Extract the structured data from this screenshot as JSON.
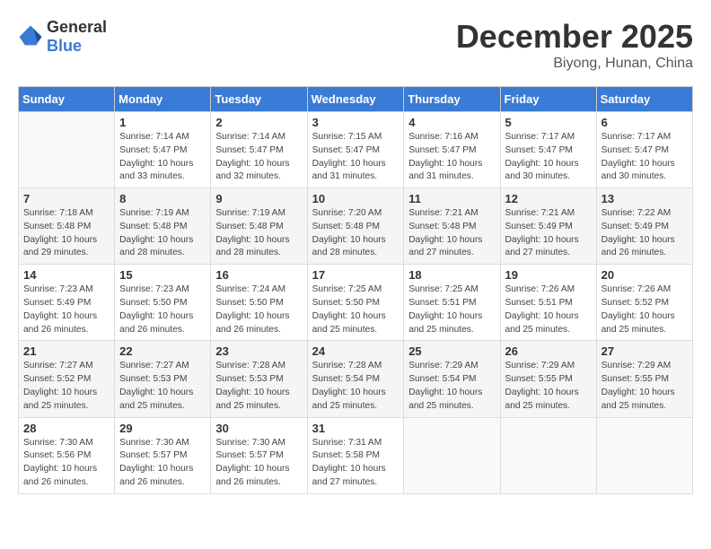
{
  "logo": {
    "general": "General",
    "blue": "Blue"
  },
  "header": {
    "month": "December 2025",
    "location": "Biyong, Hunan, China"
  },
  "weekdays": [
    "Sunday",
    "Monday",
    "Tuesday",
    "Wednesday",
    "Thursday",
    "Friday",
    "Saturday"
  ],
  "weeks": [
    [
      {
        "day": "",
        "info": ""
      },
      {
        "day": "1",
        "info": "Sunrise: 7:14 AM\nSunset: 5:47 PM\nDaylight: 10 hours\nand 33 minutes."
      },
      {
        "day": "2",
        "info": "Sunrise: 7:14 AM\nSunset: 5:47 PM\nDaylight: 10 hours\nand 32 minutes."
      },
      {
        "day": "3",
        "info": "Sunrise: 7:15 AM\nSunset: 5:47 PM\nDaylight: 10 hours\nand 31 minutes."
      },
      {
        "day": "4",
        "info": "Sunrise: 7:16 AM\nSunset: 5:47 PM\nDaylight: 10 hours\nand 31 minutes."
      },
      {
        "day": "5",
        "info": "Sunrise: 7:17 AM\nSunset: 5:47 PM\nDaylight: 10 hours\nand 30 minutes."
      },
      {
        "day": "6",
        "info": "Sunrise: 7:17 AM\nSunset: 5:47 PM\nDaylight: 10 hours\nand 30 minutes."
      }
    ],
    [
      {
        "day": "7",
        "info": "Sunrise: 7:18 AM\nSunset: 5:48 PM\nDaylight: 10 hours\nand 29 minutes."
      },
      {
        "day": "8",
        "info": "Sunrise: 7:19 AM\nSunset: 5:48 PM\nDaylight: 10 hours\nand 28 minutes."
      },
      {
        "day": "9",
        "info": "Sunrise: 7:19 AM\nSunset: 5:48 PM\nDaylight: 10 hours\nand 28 minutes."
      },
      {
        "day": "10",
        "info": "Sunrise: 7:20 AM\nSunset: 5:48 PM\nDaylight: 10 hours\nand 28 minutes."
      },
      {
        "day": "11",
        "info": "Sunrise: 7:21 AM\nSunset: 5:48 PM\nDaylight: 10 hours\nand 27 minutes."
      },
      {
        "day": "12",
        "info": "Sunrise: 7:21 AM\nSunset: 5:49 PM\nDaylight: 10 hours\nand 27 minutes."
      },
      {
        "day": "13",
        "info": "Sunrise: 7:22 AM\nSunset: 5:49 PM\nDaylight: 10 hours\nand 26 minutes."
      }
    ],
    [
      {
        "day": "14",
        "info": "Sunrise: 7:23 AM\nSunset: 5:49 PM\nDaylight: 10 hours\nand 26 minutes."
      },
      {
        "day": "15",
        "info": "Sunrise: 7:23 AM\nSunset: 5:50 PM\nDaylight: 10 hours\nand 26 minutes."
      },
      {
        "day": "16",
        "info": "Sunrise: 7:24 AM\nSunset: 5:50 PM\nDaylight: 10 hours\nand 26 minutes."
      },
      {
        "day": "17",
        "info": "Sunrise: 7:25 AM\nSunset: 5:50 PM\nDaylight: 10 hours\nand 25 minutes."
      },
      {
        "day": "18",
        "info": "Sunrise: 7:25 AM\nSunset: 5:51 PM\nDaylight: 10 hours\nand 25 minutes."
      },
      {
        "day": "19",
        "info": "Sunrise: 7:26 AM\nSunset: 5:51 PM\nDaylight: 10 hours\nand 25 minutes."
      },
      {
        "day": "20",
        "info": "Sunrise: 7:26 AM\nSunset: 5:52 PM\nDaylight: 10 hours\nand 25 minutes."
      }
    ],
    [
      {
        "day": "21",
        "info": "Sunrise: 7:27 AM\nSunset: 5:52 PM\nDaylight: 10 hours\nand 25 minutes."
      },
      {
        "day": "22",
        "info": "Sunrise: 7:27 AM\nSunset: 5:53 PM\nDaylight: 10 hours\nand 25 minutes."
      },
      {
        "day": "23",
        "info": "Sunrise: 7:28 AM\nSunset: 5:53 PM\nDaylight: 10 hours\nand 25 minutes."
      },
      {
        "day": "24",
        "info": "Sunrise: 7:28 AM\nSunset: 5:54 PM\nDaylight: 10 hours\nand 25 minutes."
      },
      {
        "day": "25",
        "info": "Sunrise: 7:29 AM\nSunset: 5:54 PM\nDaylight: 10 hours\nand 25 minutes."
      },
      {
        "day": "26",
        "info": "Sunrise: 7:29 AM\nSunset: 5:55 PM\nDaylight: 10 hours\nand 25 minutes."
      },
      {
        "day": "27",
        "info": "Sunrise: 7:29 AM\nSunset: 5:55 PM\nDaylight: 10 hours\nand 25 minutes."
      }
    ],
    [
      {
        "day": "28",
        "info": "Sunrise: 7:30 AM\nSunset: 5:56 PM\nDaylight: 10 hours\nand 26 minutes."
      },
      {
        "day": "29",
        "info": "Sunrise: 7:30 AM\nSunset: 5:57 PM\nDaylight: 10 hours\nand 26 minutes."
      },
      {
        "day": "30",
        "info": "Sunrise: 7:30 AM\nSunset: 5:57 PM\nDaylight: 10 hours\nand 26 minutes."
      },
      {
        "day": "31",
        "info": "Sunrise: 7:31 AM\nSunset: 5:58 PM\nDaylight: 10 hours\nand 27 minutes."
      },
      {
        "day": "",
        "info": ""
      },
      {
        "day": "",
        "info": ""
      },
      {
        "day": "",
        "info": ""
      }
    ]
  ]
}
